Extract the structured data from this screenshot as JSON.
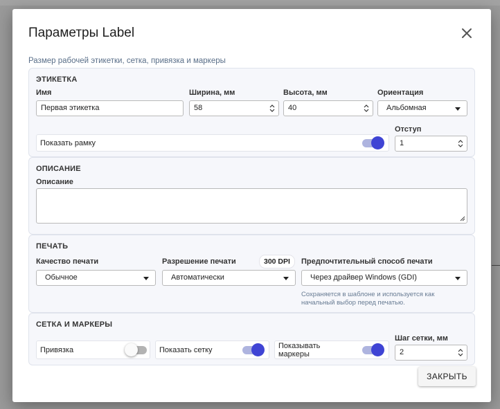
{
  "dialog": {
    "title": "Параметры Label",
    "subtitle": "Размер рабочей этикетки, сетка, привязка и маркеры",
    "close_button": "ЗАКРЫТЬ"
  },
  "label_section": {
    "title": "ЭТИКЕТКА",
    "name_label": "Имя",
    "name_value": "Первая этикетка",
    "width_label": "Ширина, мм",
    "width_value": "58",
    "height_label": "Высота, мм",
    "height_value": "40",
    "orientation_label": "Ориентация",
    "orientation_value": "Альбомная",
    "show_frame_label": "Показать рамку",
    "show_frame_on": true,
    "indent_label": "Отступ",
    "indent_value": "1"
  },
  "description_section": {
    "title": "ОПИСАНИЕ",
    "description_label": "Описание",
    "description_value": ""
  },
  "print_section": {
    "title": "ПЕЧАТЬ",
    "quality_label": "Качество печати",
    "quality_value": "Обычное",
    "resolution_label": "Разрешение печати",
    "resolution_badge": "300 DPI",
    "resolution_value": "Автоматически",
    "method_label": "Предпочтительный способ печати",
    "method_value": "Через драйвер Windows (GDI)",
    "method_hint_line1": "Сохраняется в шаблоне и используется как",
    "method_hint_line2": "начальный выбор перед печатью."
  },
  "grid_section": {
    "title": "СЕТКА И МАРКЕРЫ",
    "snap_label": "Привязка",
    "snap_on": false,
    "show_grid_label": "Показать сетку",
    "show_grid_on": true,
    "show_markers_line1": "Показывать",
    "show_markers_line2": "маркеры",
    "show_markers_on": true,
    "grid_step_label": "Шаг сетки, мм",
    "grid_step_value": "2"
  },
  "colors": {
    "accent": "#3f44d4",
    "accent_track": "#aeb4df",
    "section_bg": "#f6f7fb",
    "subtitle": "#5a6f89"
  }
}
